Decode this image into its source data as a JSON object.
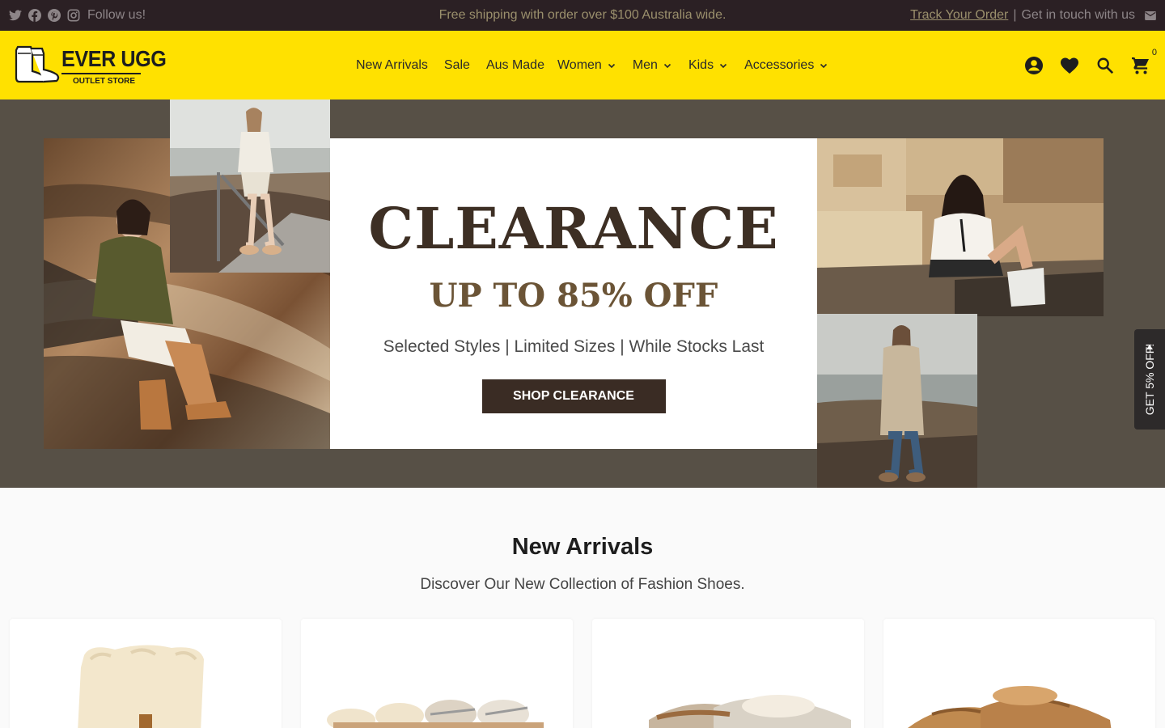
{
  "colors": {
    "topbar_bg": "#2b2024",
    "header_bg": "#ffe100",
    "hero_bg": "#575046",
    "cta_bg": "#3a2c24",
    "headline": "#3d2f24"
  },
  "topbar": {
    "social_icons": [
      "twitter-icon",
      "facebook-icon",
      "pinterest-icon",
      "instagram-icon"
    ],
    "follow_label": "Follow us!",
    "announcement": "Free shipping with order over $100 Australia wide.",
    "track_order": "Track Your Order",
    "separator": "|",
    "contact": "Get in touch with us",
    "mail_icon": "mail-icon"
  },
  "header": {
    "logo_brand": "EVER UGG",
    "logo_sub": "OUTLET STORE",
    "nav": [
      {
        "label": "New Arrivals",
        "dropdown": false
      },
      {
        "label": "Sale",
        "dropdown": false
      },
      {
        "label": "Aus Made",
        "dropdown": false
      },
      {
        "label": "Women",
        "dropdown": true
      },
      {
        "label": "Men",
        "dropdown": true
      },
      {
        "label": "Kids",
        "dropdown": true
      },
      {
        "label": "Accessories",
        "dropdown": true
      }
    ],
    "cart_count": "0"
  },
  "hero": {
    "headline": "CLEARANCE",
    "subline": "UP TO 85% OFF",
    "tagline": "Selected Styles | Limited Sizes | While Stocks Last",
    "cta": "SHOP CLEARANCE"
  },
  "sidetab": {
    "label": "GET 5% OFF!"
  },
  "new_arrivals": {
    "title": "New Arrivals",
    "subtitle": "Discover Our New Collection of Fashion Shoes."
  }
}
